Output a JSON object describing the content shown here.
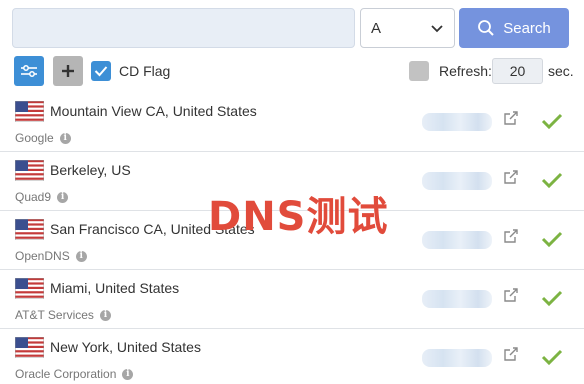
{
  "search": {
    "value": "",
    "placeholder": "",
    "record_type": "A",
    "button_label": "Search"
  },
  "toolbar": {
    "cd_flag_label": "CD Flag",
    "cd_flag_checked": true,
    "refresh_label": "Refresh:",
    "refresh_checked": false,
    "refresh_value": "20",
    "refresh_unit": "sec."
  },
  "results": [
    {
      "location": "Mountain View CA, United States",
      "provider": "Google",
      "flag": "us-flag-icon",
      "status": "ok"
    },
    {
      "location": "Berkeley, US",
      "provider": "Quad9",
      "flag": "us-flag-icon",
      "status": "ok"
    },
    {
      "location": "San Francisco CA, United States",
      "provider": "OpenDNS",
      "flag": "us-flag-icon",
      "status": "ok"
    },
    {
      "location": "Miami, United States",
      "provider": "AT&T Services",
      "flag": "us-flag-icon",
      "status": "ok"
    },
    {
      "location": "New York, United States",
      "provider": "Oracle Corporation",
      "flag": "us-flag-icon",
      "status": "ok"
    }
  ],
  "watermark": "DNS测试",
  "colors": {
    "accent": "#3d8fd6",
    "search_button": "#7593de",
    "check": "#7cb342",
    "watermark": "#e14b3b"
  }
}
